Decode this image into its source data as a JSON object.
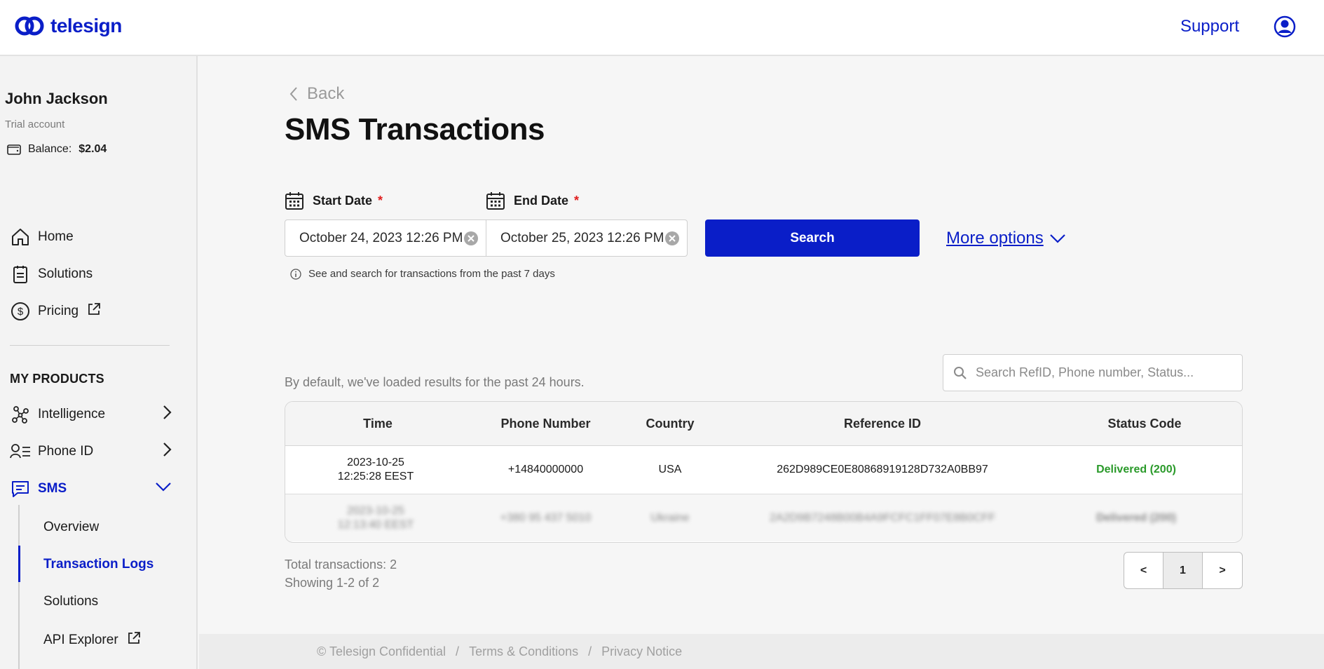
{
  "header": {
    "brand": "telesign",
    "support_label": "Support",
    "brand_color": "#0a1ec8"
  },
  "account": {
    "name": "John Jackson",
    "type": "Trial account",
    "balance_label": "Balance:",
    "balance_value": "$2.04"
  },
  "nav": {
    "home": "Home",
    "solutions": "Solutions",
    "pricing": "Pricing",
    "section_title": "MY PRODUCTS",
    "intelligence": "Intelligence",
    "phone_id": "Phone ID",
    "sms": "SMS",
    "sms_sub": {
      "overview": "Overview",
      "transaction_logs": "Transaction Logs",
      "solutions": "Solutions",
      "api_explorer": "API Explorer"
    }
  },
  "main": {
    "back_label": "Back",
    "title": "SMS Transactions",
    "start_date_label": "Start Date",
    "end_date_label": "End Date",
    "required_mark": "*",
    "start_date_value": "October 24, 2023 12:26 PM",
    "end_date_value": "October 25, 2023 12:26 PM",
    "search_button": "Search",
    "more_options": "More options",
    "hint": "See and search for transactions from the past 7 days",
    "default_note": "By default, we've loaded results for the past 24 hours.",
    "table_search_placeholder": "Search RefID, Phone number, Status...",
    "columns": {
      "time": "Time",
      "phone": "Phone Number",
      "country": "Country",
      "ref": "Reference ID",
      "status": "Status Code"
    },
    "rows": [
      {
        "date": "2023-10-25",
        "time": "12:25:28 EEST",
        "phone": "+14840000000",
        "country": "USA",
        "ref": "262D989CE0E80868919128D732A0BB97",
        "status": "Delivered (200)"
      },
      {
        "date": "2023-10-25",
        "time": "12:13:40 EEST",
        "phone": "+380 95 437 5010",
        "country": "Ukraine",
        "ref": "2A2D9B7248B00B4A9FCFC1FF07E8B0CFF",
        "status": "Delivered (200)"
      }
    ],
    "total_label": "Total transactions: 2",
    "showing_label": "Showing 1-2 of 2",
    "pager": {
      "prev": "<",
      "current": "1",
      "next": ">"
    }
  },
  "footer": {
    "copyright": "© Telesign Confidential",
    "separator": "/",
    "terms": "Terms & Conditions",
    "privacy": "Privacy Notice"
  }
}
